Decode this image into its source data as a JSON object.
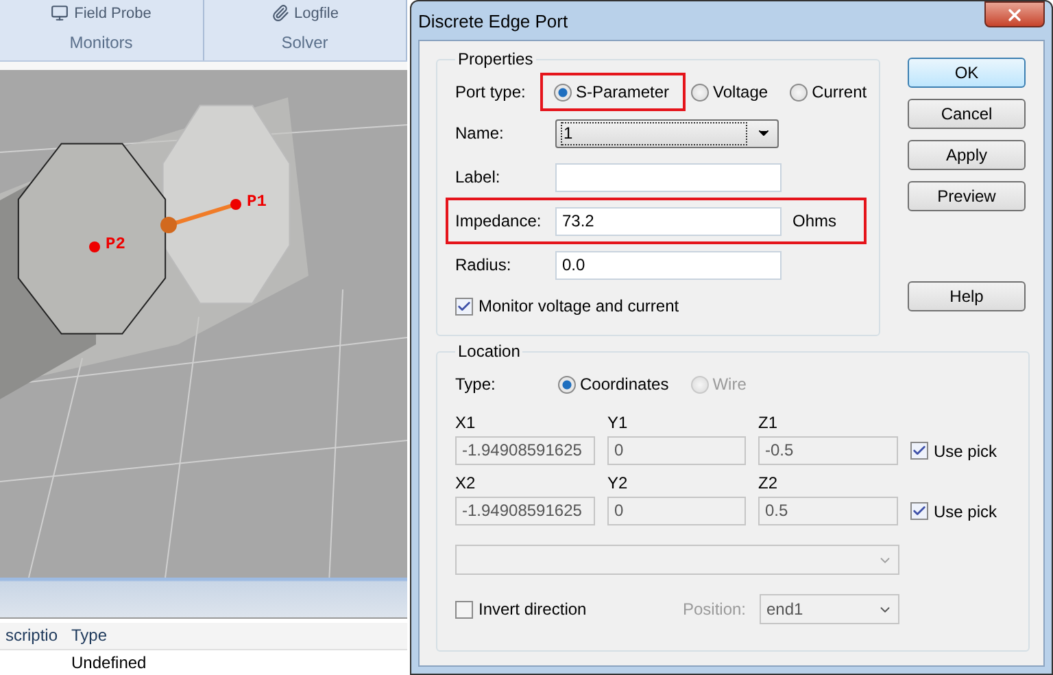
{
  "app": {
    "ribbon_groups": [
      {
        "items": [
          "Field Probe"
        ],
        "label": "Monitors"
      },
      {
        "items": [
          "Logfile"
        ],
        "label": "Solver"
      }
    ],
    "viewport": {
      "port_labels": [
        "P1",
        "P2"
      ]
    },
    "table": {
      "columns": [
        "scriptio",
        "Type"
      ],
      "rows": [
        [
          "",
          "Undefined"
        ]
      ]
    }
  },
  "dialog": {
    "title": "Discrete Edge Port",
    "properties": {
      "title": "Properties",
      "port_type": {
        "label": "Port type:",
        "options": [
          {
            "label": "S-Parameter",
            "selected": true,
            "highlighted": true
          },
          {
            "label": "Voltage",
            "selected": false,
            "highlighted": false
          },
          {
            "label": "Current",
            "selected": false,
            "highlighted": false
          }
        ]
      },
      "fields": [
        {
          "kind": "dropdown",
          "label": "Name:",
          "value": "1",
          "highlighted": false
        },
        {
          "kind": "text",
          "label": "Label:",
          "highlighted": false
        },
        {
          "kind": "text",
          "label": "Impedance:",
          "value": "73.2",
          "unit": "Ohms",
          "highlighted": true
        },
        {
          "kind": "text",
          "label": "Radius:",
          "value": "0.0",
          "highlighted": false
        }
      ],
      "monitor": {
        "label": "Monitor voltage and current",
        "checked": true
      }
    },
    "location": {
      "title": "Location",
      "type": {
        "label": "Type:",
        "options": [
          {
            "label": "Coordinates",
            "selected": true,
            "disabled": false
          },
          {
            "label": "Wire",
            "selected": false,
            "disabled": true
          }
        ]
      },
      "points": [
        {
          "fields": [
            {
              "label": "X1",
              "value": "-1.94908591625",
              "disabled": true
            },
            {
              "label": "Y1",
              "value": "0",
              "disabled": true
            },
            {
              "label": "Z1",
              "value": "-0.5",
              "disabled": true
            }
          ],
          "use_pick": {
            "label": "Use pick",
            "checked": true
          }
        },
        {
          "fields": [
            {
              "label": "X2",
              "value": "-1.94908591625",
              "disabled": true
            },
            {
              "label": "Y2",
              "value": "0",
              "disabled": true
            },
            {
              "label": "Z2",
              "value": "0.5",
              "disabled": true
            }
          ],
          "use_pick": {
            "label": "Use pick",
            "checked": true
          }
        }
      ],
      "wide_dropdown": {
        "disabled": true
      },
      "invert": {
        "label": "Invert direction",
        "checked": false
      },
      "position": {
        "label": "Position:",
        "value": "end1",
        "disabled": true
      }
    },
    "buttons": [
      {
        "label": "OK",
        "default": true
      },
      {
        "label": "Cancel",
        "default": false
      },
      {
        "label": "Apply",
        "default": false
      },
      {
        "label": "Preview",
        "default": false
      }
    ],
    "help_button": {
      "label": "Help"
    }
  }
}
